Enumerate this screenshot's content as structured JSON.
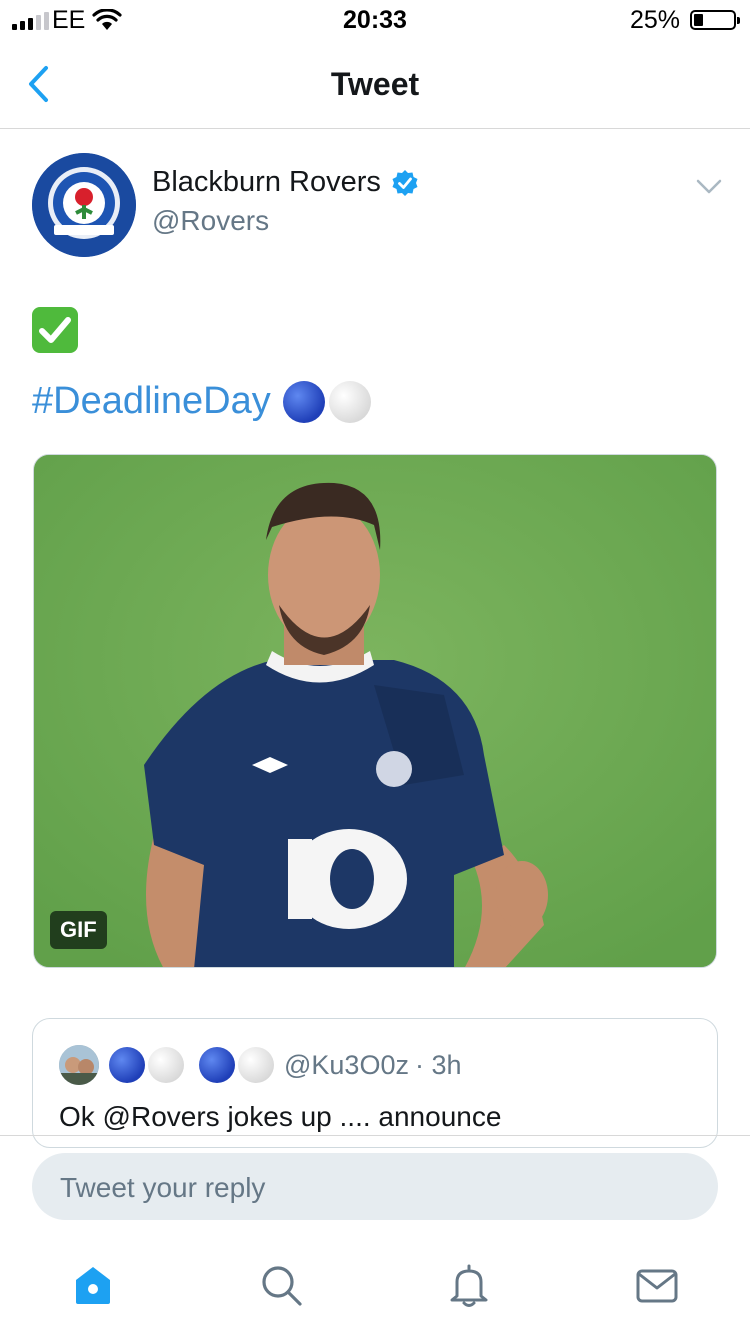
{
  "status_bar": {
    "carrier": "EE",
    "time": "20:33",
    "battery": "25%"
  },
  "nav": {
    "title": "Tweet"
  },
  "tweet": {
    "author_name": "Blackburn Rovers",
    "handle": "@Rovers",
    "hashtag": "#DeadlineDay",
    "media_badge": "GIF"
  },
  "quoted_tweet": {
    "handle": "@Ku3O0z",
    "time": "· 3h",
    "text": "Ok @Rovers jokes up .... announce"
  },
  "reply": {
    "placeholder": "Tweet your reply"
  },
  "tab_bar": {
    "items": [
      "home-icon",
      "search-icon",
      "notifications-icon",
      "messages-icon"
    ],
    "active": "home-icon"
  },
  "colors": {
    "accent": "#1da1f2",
    "link": "#3a8fd9",
    "verified": "#1da1f2"
  }
}
